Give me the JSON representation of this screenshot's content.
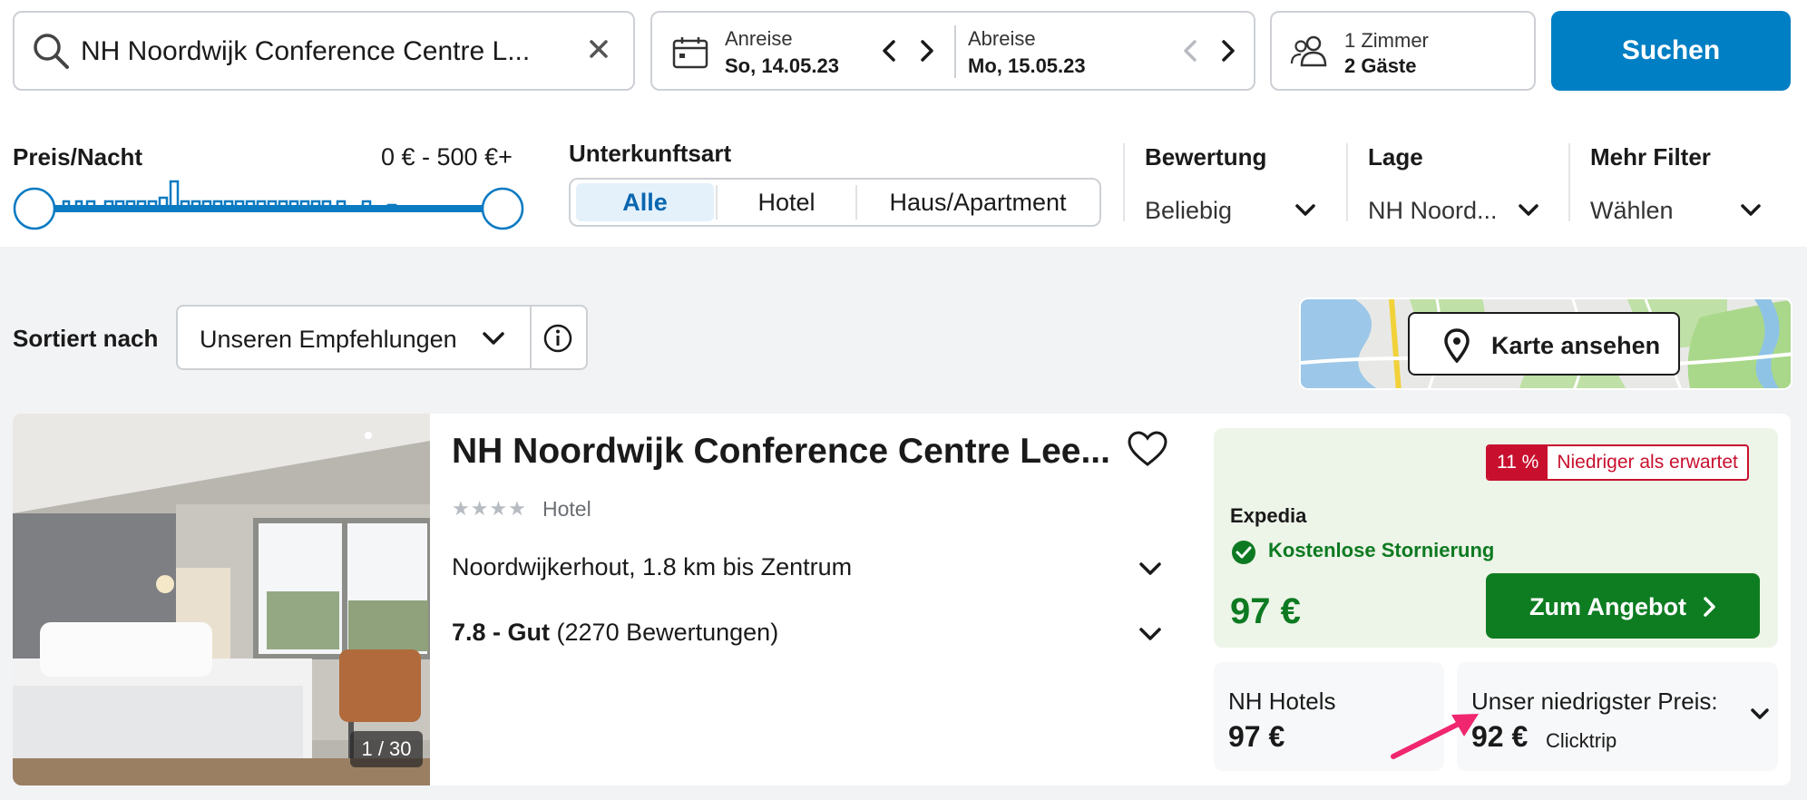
{
  "search": {
    "query": "NH Noordwijk Conference Centre L...",
    "clear_icon": "close-icon",
    "search_icon": "search-icon"
  },
  "dates": {
    "checkin_label": "Anreise",
    "checkin_value": "So, 14.05.23",
    "checkout_label": "Abreise",
    "checkout_value": "Mo, 15.05.23",
    "calendar_icon": "calendar-icon"
  },
  "guests": {
    "rooms": "1 Zimmer",
    "guests": "2 Gäste",
    "icon": "people-icon"
  },
  "search_button": "Suchen",
  "filters": {
    "price": {
      "title": "Preis/Nacht",
      "range": "0 € - 500 €+"
    },
    "accommodation": {
      "title": "Unterkunftsart",
      "options": [
        "Alle",
        "Hotel",
        "Haus/Apartment"
      ],
      "selected": "Alle"
    },
    "rating": {
      "title": "Bewertung",
      "value": "Beliebig"
    },
    "location": {
      "title": "Lage",
      "value": "NH Noord..."
    },
    "more": {
      "title": "Mehr Filter",
      "value": "Wählen"
    }
  },
  "sort": {
    "label": "Sortiert nach",
    "value": "Unseren Empfehlungen",
    "info_icon": "info-icon"
  },
  "map": {
    "button_label": "Karte ansehen",
    "icon": "map-pin-icon"
  },
  "hotel": {
    "name": "NH Noordwijk Conference Centre Lee...",
    "stars": "★★★★",
    "star_count": 4,
    "type": "Hotel",
    "location": "Noordwijkerhout, 1.8 km bis Zentrum",
    "rating_score": "7.8 - Gut",
    "rating_count": "(2270 Bewertungen)",
    "photo_counter": "1 / 30",
    "deal": {
      "badge_pct": "11 %",
      "badge_text": "Niedriger als erwartet",
      "provider": "Expedia",
      "cancellation": "Kostenlose Stornierung",
      "price": "97 €",
      "button": "Zum Angebot"
    },
    "alternatives": [
      {
        "provider": "NH Hotels",
        "price": "97 €"
      },
      {
        "label": "Unser niedrigster Preis:",
        "price": "92 €",
        "provider": "Clicktrip"
      }
    ]
  },
  "colors": {
    "primary_blue": "#007fc4",
    "deal_green": "#0e7d22",
    "price_green": "#0d7a21",
    "badge_red": "#c8102e",
    "annotation_pink": "#f0266f"
  }
}
